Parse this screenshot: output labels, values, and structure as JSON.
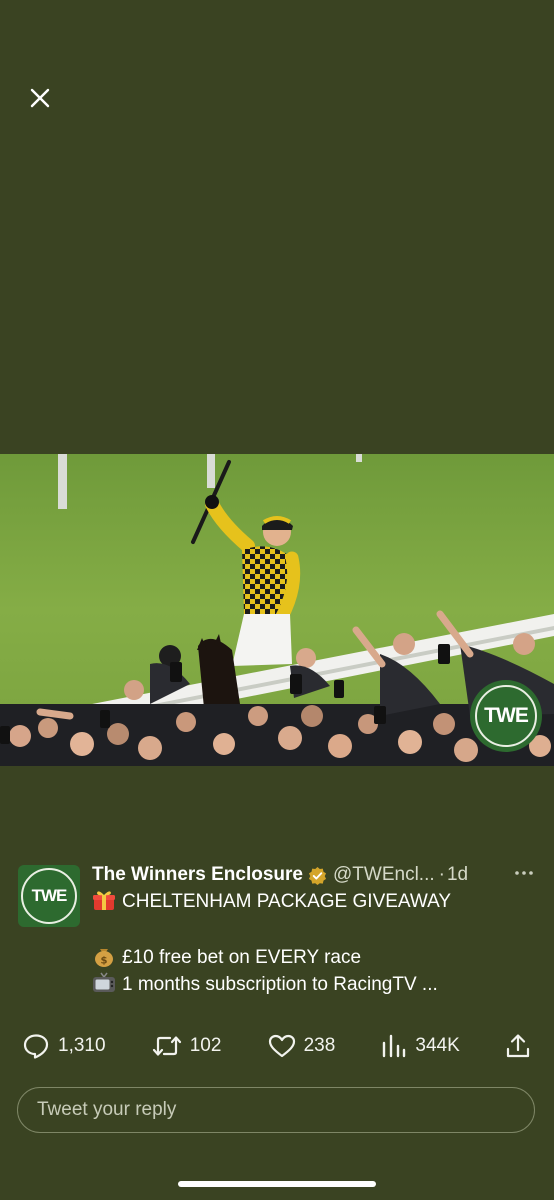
{
  "theme": {
    "background": "#3a4322",
    "accent_green": "#2d6a2f",
    "verified_color": "#d4a52a"
  },
  "viewer": {
    "close_icon": "close-icon"
  },
  "media": {
    "description_icon": "photo",
    "watermark_text": "TWE"
  },
  "tweet": {
    "avatar_text": "TWE",
    "display_name": "The Winners Enclosure",
    "handle": "@TWEncl...",
    "separator": "·",
    "time": "1d",
    "more_icon": "more-icon",
    "line1": "CHELTENHAM PACKAGE GIVEAWAY",
    "line1_icon": "gift-emoji",
    "line2": "£10 free bet on EVERY race",
    "line2_icon": "money-bag-emoji",
    "line3": "1 months subscription to RacingTV ...",
    "line3_icon": "television-emoji"
  },
  "actions": {
    "replies": "1,310",
    "retweets": "102",
    "likes": "238",
    "views": "344K"
  },
  "reply": {
    "placeholder": "Tweet your reply"
  }
}
